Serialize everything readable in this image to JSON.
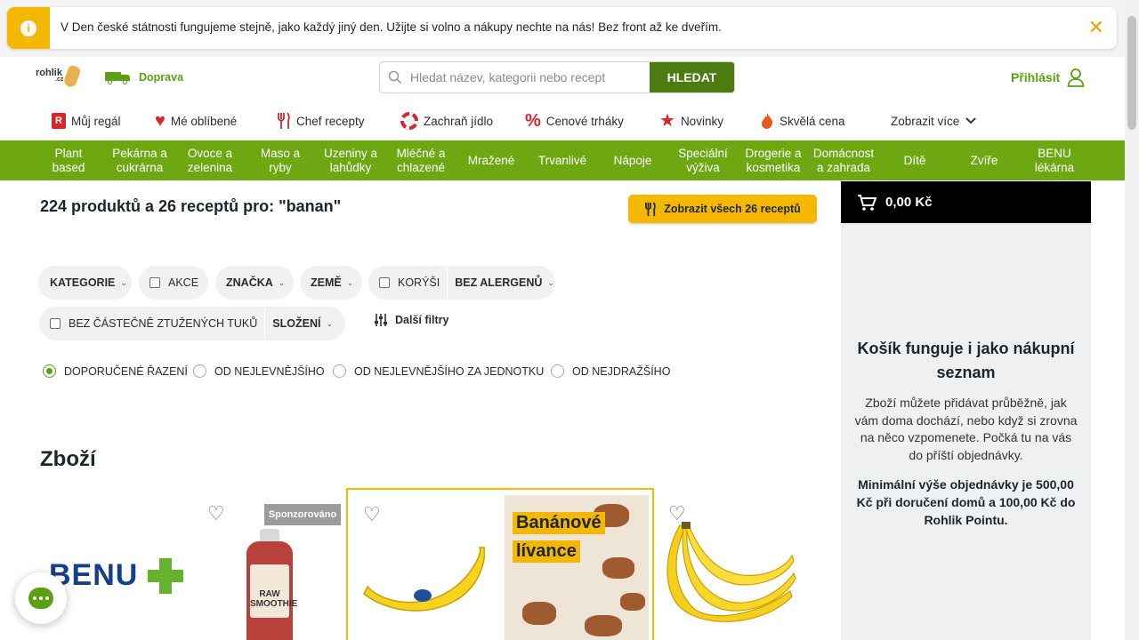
{
  "notice": {
    "text": "V Den české státnosti fungujeme stejně, jako každý jiný den. Užijte si volno a nákupy nechte na nás! Bez front až ke dveřím.",
    "close": "✕"
  },
  "header": {
    "logo": "rohlik",
    "logo_tld": ".cz",
    "doprava": "Doprava",
    "search_placeholder": "Hledat název, kategorii nebo recept",
    "search_button": "HLEDAT",
    "login": "Přihlásit"
  },
  "subnav": [
    {
      "label": "Můj regál",
      "icon": "shelf-icon"
    },
    {
      "label": "Mé oblíbené",
      "icon": "heart-icon"
    },
    {
      "label": "Chef recepty",
      "icon": "cutlery-icon"
    },
    {
      "label": "Zachraň jídlo",
      "icon": "lifebuoy-icon"
    },
    {
      "label": "Cenové trháky",
      "icon": "percent-icon"
    },
    {
      "label": "Novinky",
      "icon": "star-icon"
    },
    {
      "label": "Skvělá cena",
      "icon": "flame-icon"
    },
    {
      "label": "Zobrazit více",
      "icon": "chevron-down-icon"
    }
  ],
  "categories": [
    "Plant based",
    "Pekárna a cukrárna",
    "Ovoce a zelenina",
    "Maso a ryby",
    "Uzeniny a lahůdky",
    "Mléčné a chlazené",
    "Mražené",
    "Trvanlivé",
    "Nápoje",
    "Speciální výživa",
    "Drogerie a kosmetika",
    "Domácnost a zahrada",
    "Dítě",
    "Zvíře",
    "BENU lékárna"
  ],
  "results": {
    "title": "224 produktů a 26 receptů pro: \"banan\"",
    "recipes_button": "Zobrazit všech 26 receptů"
  },
  "filters": {
    "kategorie": "KATEGORIE",
    "akce": "AKCE",
    "znacka": "ZNAČKA",
    "zeme": "ZEMĚ",
    "korysi": "KORÝŠI",
    "bez_alergenu": "BEZ ALERGENŮ",
    "bez_tuku": "BEZ ČÁSTEČNĚ ZTUŽENÝCH TUKŮ",
    "slozeni": "SLOŽENÍ",
    "dalsi": "Další filtry"
  },
  "sort": [
    {
      "label": "DOPORUČENÉ ŘAZENÍ",
      "selected": true
    },
    {
      "label": "OD NEJLEVNĚJŠÍHO",
      "selected": false
    },
    {
      "label": "OD NEJLEVNĚJŠÍHO ZA JEDNOTKU",
      "selected": false
    },
    {
      "label": "OD NEJDRAŽŠÍHO",
      "selected": false
    }
  ],
  "section_title": "Zboží",
  "products": {
    "sponsored": "Sponzorováno",
    "benu": "BENU",
    "smoothie_label": "RAW SMOOTHIE",
    "recipe_line1": "Banánové",
    "recipe_line2": "lívance"
  },
  "cart": {
    "total": "0,00 Kč",
    "heading": "Košík funguje i jako nákupní seznam",
    "text": "Zboží můžete přidávat průběžně, jak vám doma dochází, nebo když si zrovna na něco vzpomenete. Počká tu na vás do příští objednávky.",
    "min_order": "Minimální výše objednávky je 500,00 Kč při doručení domů a 100,00 Kč do Rohlik Pointu."
  },
  "colors": {
    "brand_green": "#6da711",
    "accent_yellow": "#f5b800",
    "dark_green": "#4b7b11"
  }
}
